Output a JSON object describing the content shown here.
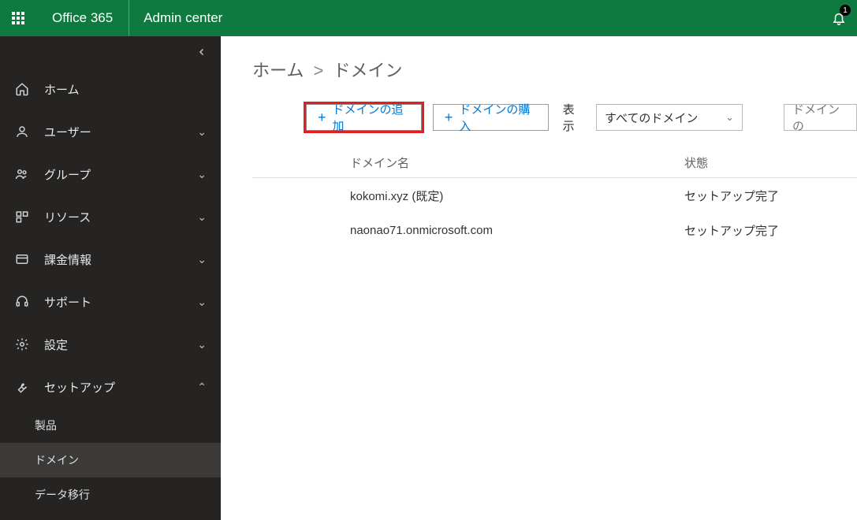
{
  "topbar": {
    "brand": "Office 365",
    "area": "Admin center",
    "notification_count": "1"
  },
  "sidebar": {
    "items": [
      {
        "label": "ホーム",
        "expandable": false
      },
      {
        "label": "ユーザー",
        "expandable": true
      },
      {
        "label": "グループ",
        "expandable": true
      },
      {
        "label": "リソース",
        "expandable": true
      },
      {
        "label": "課金情報",
        "expandable": true
      },
      {
        "label": "サポート",
        "expandable": true
      },
      {
        "label": "設定",
        "expandable": true
      },
      {
        "label": "セットアップ",
        "expandable": true,
        "expanded": true,
        "children": [
          {
            "label": "製品",
            "active": false
          },
          {
            "label": "ドメイン",
            "active": true
          },
          {
            "label": "データ移行",
            "active": false
          }
        ]
      }
    ]
  },
  "breadcrumb": {
    "home": "ホーム",
    "current": "ドメイン"
  },
  "toolbar": {
    "add_domain": "ドメインの追加",
    "buy_domain": "ドメインの購入",
    "show_label": "表示",
    "filter_value": "すべてのドメイン",
    "search_placeholder": "ドメインの"
  },
  "table": {
    "headers": {
      "name": "ドメイン名",
      "status": "状態"
    },
    "rows": [
      {
        "name": "kokomi.xyz (既定)",
        "status": "セットアップ完了"
      },
      {
        "name": "naonao71.onmicrosoft.com",
        "status": "セットアップ完了"
      }
    ]
  }
}
